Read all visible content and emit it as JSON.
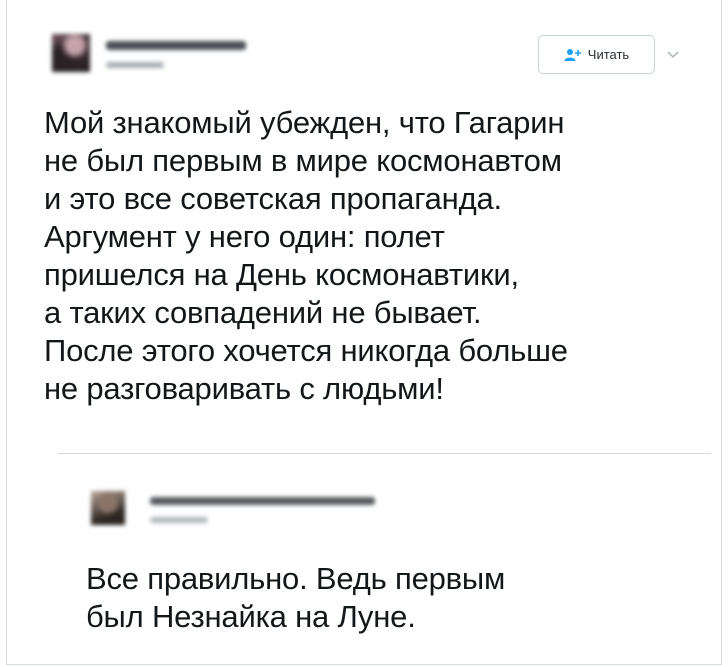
{
  "tweet": {
    "follow_label": "Читать",
    "text": "Мой знакомый убежден, что Гагарин\nне был первым в мире космонавтом\nи это все советская пропаганда.\nАргумент у него один: полет\nпришелся на День космонавтики,\nа таких совпадений не бывает.\nПосле этого хочется никогда больше\nне разговаривать с людьми!",
    "icons": {
      "follow": "add-user-icon",
      "more": "chevron-down-icon"
    },
    "colors": {
      "accent": "#1da1f2",
      "text": "#14171a",
      "border": "#c9d3da"
    }
  },
  "reply": {
    "text": "Все правильно. Ведь первым\nбыл Незнайка на Луне."
  }
}
